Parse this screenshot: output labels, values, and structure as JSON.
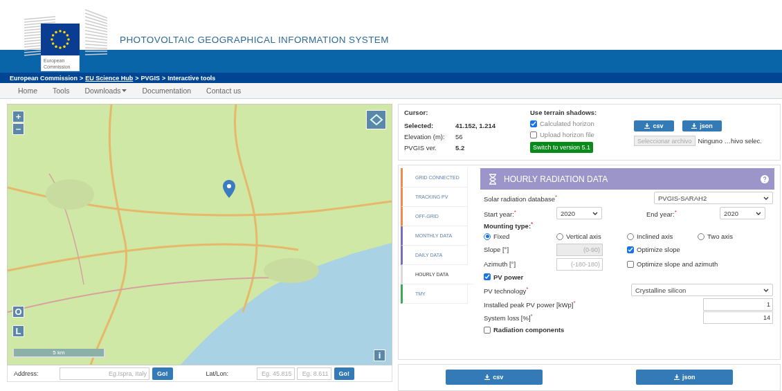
{
  "header": {
    "logo_lines": [
      "European",
      "Commission"
    ],
    "title": "PHOTOVOLTAIC GEOGRAPHICAL INFORMATION SYSTEM"
  },
  "breadcrumb": [
    {
      "label": "European Commission",
      "link": false
    },
    {
      "label": "EU Science Hub",
      "link": true
    },
    {
      "label": "PVGIS",
      "link": false
    },
    {
      "label": "Interactive tools",
      "link": false
    }
  ],
  "breadcrumb_separator": ">",
  "nav": [
    {
      "label": "Home",
      "dropdown": false
    },
    {
      "label": "Tools",
      "dropdown": false
    },
    {
      "label": "Downloads",
      "dropdown": true
    },
    {
      "label": "Documentation",
      "dropdown": false
    },
    {
      "label": "Contact us",
      "dropdown": false
    }
  ],
  "map": {
    "zoom_in": "+",
    "zoom_out": "−",
    "left_buttons": [
      "O",
      "L"
    ],
    "info_button": "i",
    "scale": "5 km"
  },
  "address_bar": {
    "address_label": "Address:",
    "address_placeholder": "Eg.Ispra, Italy",
    "go": "Go!",
    "latlon_label": "Lat/Lon:",
    "lat_placeholder": "Eg. 45.815",
    "lon_placeholder": "Eg. 8.611",
    "go_latlon": "Go!"
  },
  "info": {
    "cursor_label": "Cursor:",
    "rows": [
      {
        "label": "Selected:",
        "value": "41.152, 1.214",
        "label_bold": true,
        "value_bold": true
      },
      {
        "label": "Elevation (m):",
        "value": "56",
        "label_bold": false,
        "value_bold": false
      },
      {
        "label": "PVGIS ver.",
        "value": "5.2",
        "label_bold": false,
        "value_bold": true
      }
    ]
  },
  "shadows": {
    "title": "Use terrain shadows:",
    "options": [
      {
        "label": "Calculated horizon",
        "checked": true
      },
      {
        "label": "Upload horizon file",
        "checked": false
      }
    ],
    "switch_button": "Switch to version 5.1"
  },
  "downloads": {
    "buttons": [
      "csv",
      "json"
    ],
    "file_button": "Seleccionar archivo",
    "file_status": "Ninguno …hivo selec."
  },
  "tabs": [
    {
      "label": "GRID CONNECTED",
      "color": "#f08a4b",
      "selected": false
    },
    {
      "label": "TRACKING PV",
      "color": "#f08a4b",
      "selected": false
    },
    {
      "label": "OFF-GRID",
      "color": "#f08a4b",
      "selected": false
    },
    {
      "label": "MONTHLY DATA",
      "color": "#7b6bb8",
      "selected": false
    },
    {
      "label": "DAILY DATA",
      "color": "#7b6bb8",
      "selected": false
    },
    {
      "label": "HOURLY DATA",
      "color": "#d9d9d9",
      "selected": true
    },
    {
      "label": "TMY",
      "color": "#3aaa5a",
      "selected": false
    }
  ],
  "panel": {
    "title": "HOURLY RADIATION DATA",
    "database": {
      "label": "Solar radiation database$^{*}$",
      "value": "PVGIS-SARAH2"
    },
    "start_year": {
      "label": "Start year:$^{*}$",
      "value": "2020"
    },
    "end_year": {
      "label": "End year:$^{*}$",
      "value": "2020"
    },
    "mounting_label": "Mounting type:$^{*}$",
    "mounting": [
      {
        "label": "Fixed",
        "selected": true
      },
      {
        "label": "Vertical axis",
        "selected": false
      },
      {
        "label": "Inclined axis",
        "selected": false
      },
      {
        "label": "Two axis",
        "selected": false
      }
    ],
    "slope": {
      "label": "Slope [°]",
      "placeholder": "(0-90)",
      "disabled": true
    },
    "azimuth": {
      "label": "Azimuth [°]",
      "placeholder": "(-180-180)",
      "disabled": false
    },
    "optimize": [
      {
        "label": "Optimize slope",
        "checked": true
      },
      {
        "label": "Optimize slope and azimuth",
        "checked": false
      }
    ],
    "pv_power": {
      "label": "PV power",
      "checked": true
    },
    "pv_technology": {
      "label": "PV technology$^{*}$",
      "value": "Crystalline silicon"
    },
    "peak_power": {
      "label": "Installed peak PV power [kWp]$^{*}$",
      "value": "1"
    },
    "system_loss": {
      "label": "System loss [%]$^{*}$",
      "value": "14"
    },
    "radiation_components": {
      "label": "Radiation components",
      "checked": false
    }
  },
  "bottom_buttons": [
    "csv",
    "json"
  ]
}
